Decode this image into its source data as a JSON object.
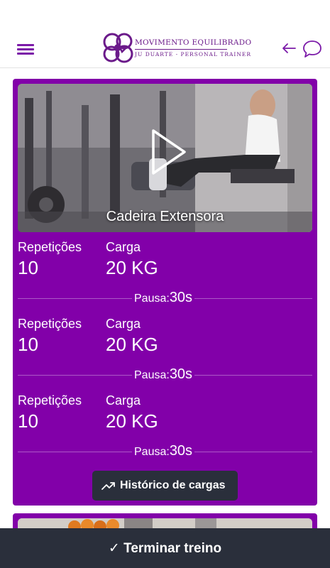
{
  "header": {
    "logo_title": "MOVIMENTO EQUILIBRADO",
    "logo_subtitle": "JU DUARTE - PERSONAL TRAINER",
    "brand_color": "#7b1aa8",
    "icons": [
      "menu-icon",
      "arrow-left-icon",
      "chat-bubble-icon"
    ]
  },
  "exercise": {
    "name": "Cadeira Extensora",
    "card_color": "#8200a9",
    "sets": [
      {
        "reps_label": "Repetições",
        "reps": "10",
        "load_label": "Carga",
        "load": "20 KG",
        "pause_label": "Pausa:",
        "pause": "30s"
      },
      {
        "reps_label": "Repetições",
        "reps": "10",
        "load_label": "Carga",
        "load": "20 KG",
        "pause_label": "Pausa:",
        "pause": "30s"
      },
      {
        "reps_label": "Repetições",
        "reps": "10",
        "load_label": "Carga",
        "load": "20 KG",
        "pause_label": "Pausa:",
        "pause": "30s"
      }
    ],
    "history_button": "Histórico de cargas"
  },
  "footer": {
    "finish_label": "✓ Terminar treino",
    "button_color": "#2a2f3b"
  }
}
